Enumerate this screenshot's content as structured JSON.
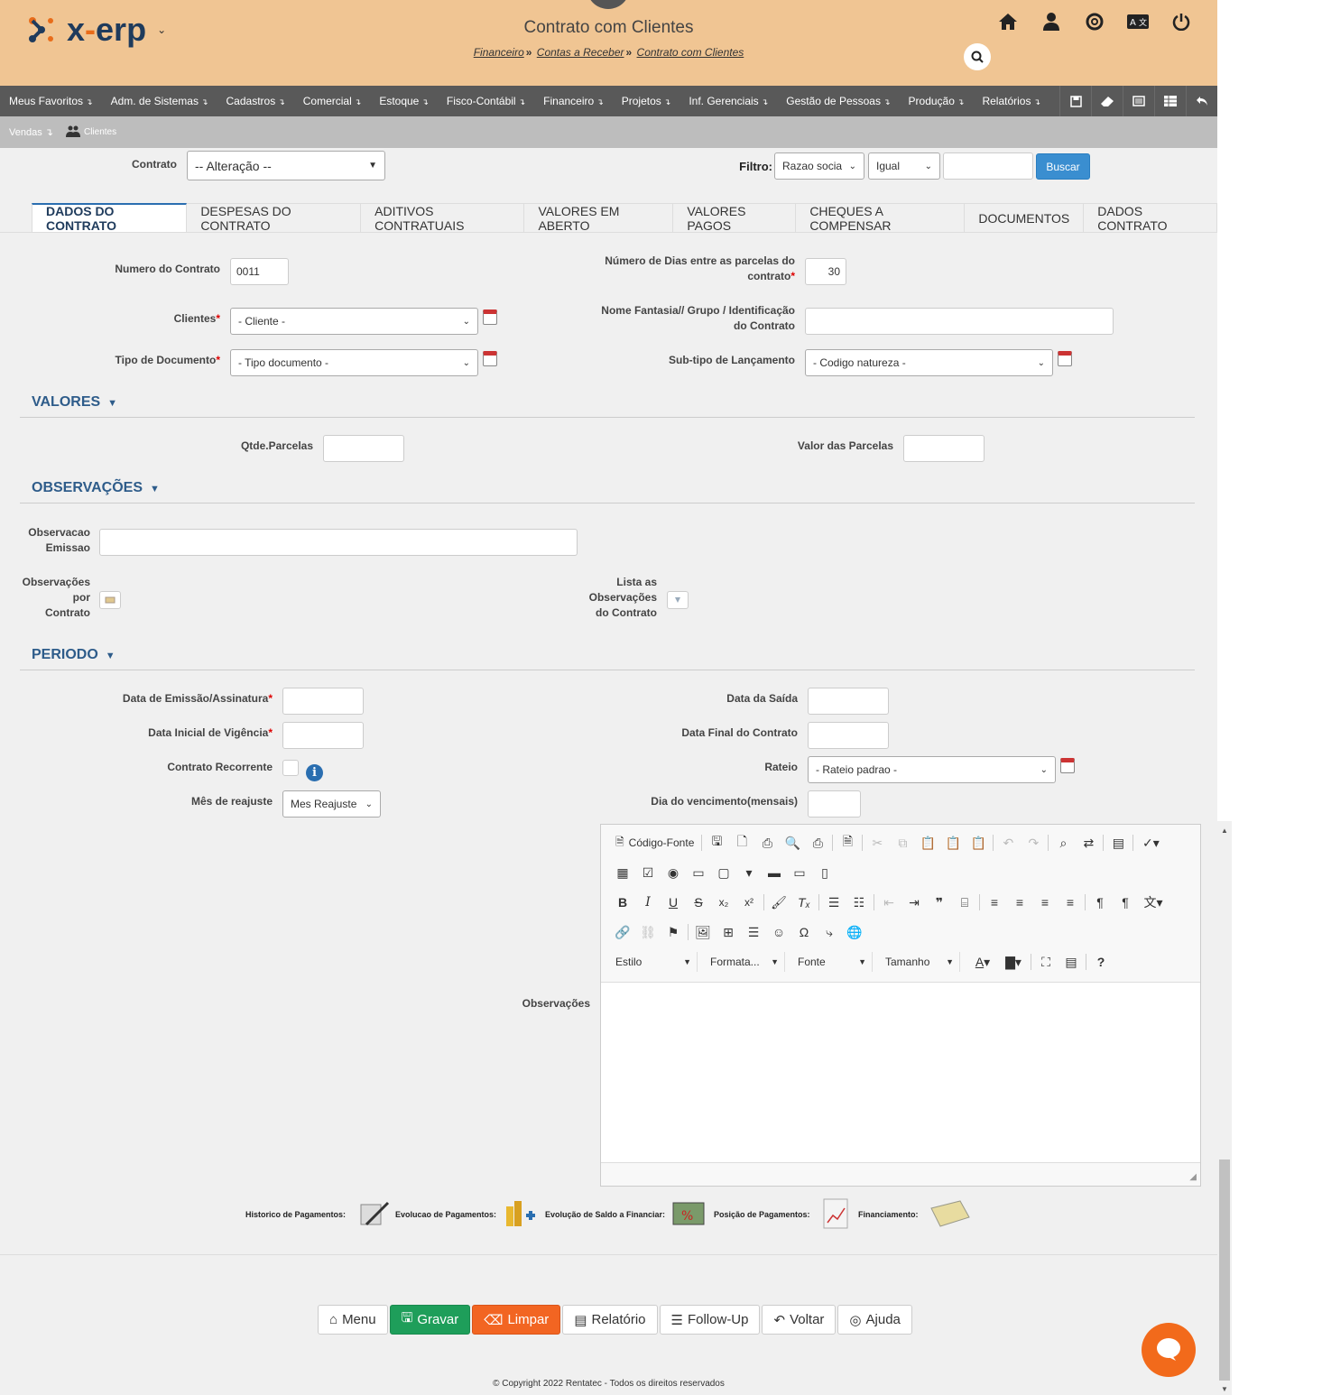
{
  "header": {
    "app_name": "x-erp",
    "title": "Contrato com Clientes",
    "breadcrumb": [
      "Financeiro",
      "Contas a Receber",
      "Contrato com Clientes"
    ],
    "brand_color": "#f0c593"
  },
  "menu": {
    "items": [
      "Meus Favoritos",
      "Adm. de Sistemas",
      "Cadastros",
      "Comercial",
      "Estoque",
      "Fisco-Contábil",
      "Financeiro",
      "Projetos",
      "Inf. Gerenciais",
      "Gestão de Pessoas",
      "Produção",
      "Relatórios"
    ],
    "sub": [
      "Vendas",
      "Clientes"
    ]
  },
  "filter": {
    "contrato_label": "Contrato",
    "contrato_value": "-- Alteração --",
    "filtro_label": "Filtro:",
    "field": "Razao socia",
    "op": "Igual",
    "value": "",
    "buscar": "Buscar"
  },
  "tabs": [
    "DADOS DO CONTRATO",
    "DESPESAS DO CONTRATO",
    "ADITIVOS CONTRATUAIS",
    "VALORES EM ABERTO",
    "VALORES PAGOS",
    "CHEQUES A COMPENSAR",
    "DOCUMENTOS",
    "DADOS CONTRATO"
  ],
  "form": {
    "numero_label": "Numero do Contrato",
    "numero_value": "0011",
    "dias_label1": "Número de Dias entre as parcelas do",
    "dias_label2": "contrato",
    "dias_value": "30",
    "clientes_label": "Clientes",
    "clientes_value": "- Cliente -",
    "fantasia_label1": "Nome Fantasia// Grupo / Identificação",
    "fantasia_label2": "do Contrato",
    "tipo_label": "Tipo de Documento",
    "tipo_value": "- Tipo documento -",
    "subtipo_label": "Sub-tipo de Lançamento",
    "subtipo_value": "- Codigo natureza -"
  },
  "valores": {
    "title": "VALORES",
    "qtde_label": "Qtde.Parcelas",
    "valor_label": "Valor das Parcelas"
  },
  "obs": {
    "title": "OBSERVAÇÕES",
    "emissao_label1": "Observacao",
    "emissao_label2": "Emissao",
    "por_label1": "Observações",
    "por_label2": "por",
    "por_label3": "Contrato",
    "lista_label1": "Lista as",
    "lista_label2": "Observações",
    "lista_label3": "do Contrato"
  },
  "periodo": {
    "title": "PERIODO",
    "emissao_label": "Data de Emissão/Assinatura",
    "saida_label": "Data da Saída",
    "inicial_label": "Data Inicial de Vigência",
    "final_label": "Data Final do Contrato",
    "recorrente_label": "Contrato Recorrente",
    "rateio_label": "Rateio",
    "rateio_value": "- Rateio padrao -",
    "reajuste_label": "Mês de reajuste",
    "reajuste_value": "Mes Reajuste",
    "vencimento_label": "Dia do vencimento(mensais)",
    "observacoes_label": "Observações"
  },
  "editor": {
    "source_label": "Código-Fonte",
    "combos": [
      "Estilo",
      "Formata...",
      "Fonte",
      "Tamanho"
    ]
  },
  "links": {
    "historico": "Historico de Pagamentos:",
    "evolucao": "Evolucao de Pagamentos:",
    "saldo": "Evolução de Saldo a Financiar:",
    "posicao": "Posição de Pagamentos:",
    "financiamento": "Financiamento:"
  },
  "buttons": {
    "menu": "Menu",
    "gravar": "Gravar",
    "limpar": "Limpar",
    "relatorio": "Relatório",
    "followup": "Follow-Up",
    "voltar": "Voltar",
    "ajuda": "Ajuda"
  },
  "footer": "© Copyright 2022 Rentatec - Todos os direitos reservados"
}
